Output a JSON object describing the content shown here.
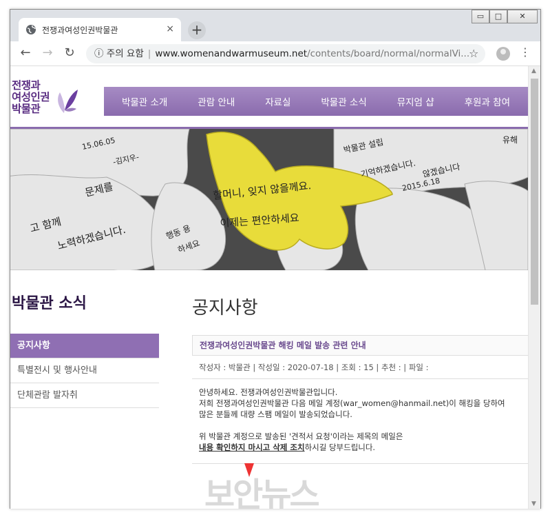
{
  "browser": {
    "tab_title": "전쟁과여성인권박물관",
    "tab_close": "×",
    "new_tab": "+",
    "security_label": "주의 요함",
    "url_host": "www.womenandwarmuseum.net",
    "url_path": "/contents/board/normal/normalVi...",
    "win_min": "▭",
    "win_max": "□",
    "win_close": "✕"
  },
  "site": {
    "logo_lines": [
      "전쟁과",
      "여성인권",
      "박물관"
    ],
    "nav": [
      "박물관 소개",
      "관람 안내",
      "자료실",
      "박물관 소식",
      "뮤지엄 샵",
      "후원과 참여"
    ]
  },
  "hero": {
    "yellow_card_line1": "할머니, 잊지 않을께요.",
    "yellow_card_line2": "이제는 편안하세요",
    "notes": [
      "15.06.05",
      "-김지우-",
      "문제를",
      "고 함께",
      "노력하겠습니다.",
      "박물관 설립",
      "기억하겠습니다.",
      "2015.6.18",
      "유해",
      "않겠습니다",
      "행동 용",
      "하세요"
    ]
  },
  "sidebar": {
    "title": "박물관 소식",
    "items": [
      "공지사항",
      "특별전시 및 행사안내",
      "단체관람 발자취"
    ]
  },
  "post": {
    "page_title": "공지사항",
    "title": "전쟁과여성인권박물관 해킹 메일 발송 관련 안내",
    "meta": "작성자 : 박물관 | 작성일 : 2020-07-18 | 조회 : 15 | 추천 : | 파일 :",
    "body_lines": [
      "안녕하세요. 전쟁과여성인권박물관입니다.",
      "저희 전쟁과여성인권박물관 다음 메일 계정(war_women@hanmail.net)이 해킹을 당하여",
      "많은 분들께 대량 스팸 메일이 발송되었습니다."
    ],
    "body_line4": "위 박물관 계정으로 발송된 '견적서 요청'이라는 제목의 메일은",
    "body_line5_underlined": "내용 확인하지 마시고 삭제 조치",
    "body_line5_rest": "하시길 당부드립니다."
  },
  "watermark": "보안뉴스",
  "colors": {
    "accent": "#8f6fb3",
    "nav_bg": "#9a7cbd",
    "title_dark": "#2b1645",
    "yellow_card": "#e8dc3a"
  }
}
